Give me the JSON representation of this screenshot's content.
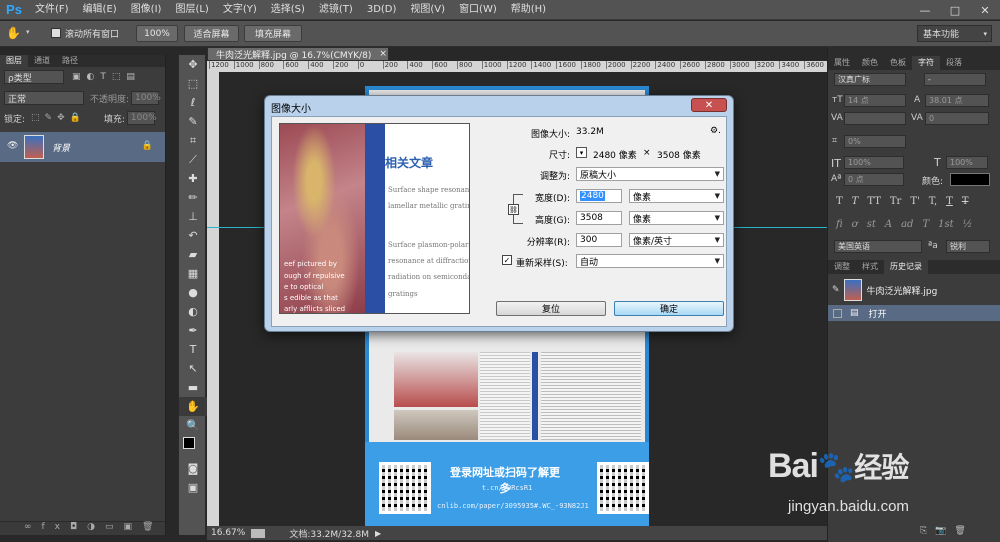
{
  "menubar": {
    "logo": "Ps",
    "items": [
      "文件(F)",
      "编辑(E)",
      "图像(I)",
      "图层(L)",
      "文字(Y)",
      "选择(S)",
      "滤镜(T)",
      "3D(D)",
      "视图(V)",
      "窗口(W)",
      "帮助(H)"
    ],
    "controls": [
      "—",
      "□",
      "✕"
    ]
  },
  "options": {
    "scroll_all_windows": "滚动所有窗口",
    "zoom_100": "100%",
    "fit_screen": "适合屏幕",
    "fill_screen": "填充屏幕",
    "workspace": "基本功能"
  },
  "layers_panel": {
    "tabs": [
      "图层",
      "通道",
      "路径"
    ],
    "kind_label": "ρ类型",
    "blend_mode": "正常",
    "opacity_label": "不透明度:",
    "opacity_value": "100%",
    "lock_label": "锁定:",
    "fill_label": "填充:",
    "fill_value": "100%",
    "layer_name": "背景"
  },
  "document": {
    "tab_title": "牛肉泛光解释.jpg @ 16.7%(CMYK/8)",
    "close": "×",
    "ruler_ticks": [
      "1200",
      "1000",
      "800",
      "600",
      "400",
      "200",
      "0",
      "200",
      "400",
      "600",
      "800",
      "1000",
      "1200",
      "1400",
      "1600",
      "1800",
      "2000",
      "2200",
      "2400",
      "2600",
      "2800",
      "3000",
      "3200",
      "3400",
      "3600"
    ],
    "zoom": "16.67%",
    "doc_info": "文档:33.2M/32.8M",
    "poster_cta": "登录网址或扫码了解更多",
    "poster_link1": "t.cn/z0RcsR1",
    "poster_link2": "cnlib.com/paper/3095935#.WC_-93N82J1"
  },
  "dialog": {
    "title": "图像大小",
    "close": "✕",
    "image_size_label": "图像大小:",
    "image_size_value": "33.2M",
    "gear": "⚙.",
    "dimensions_label": "尺寸:",
    "dimensions_width": "2480 像素",
    "dimensions_x": "×",
    "dimensions_height": "3508 像素",
    "fit_to_label": "调整为:",
    "fit_to_value": "原稿大小",
    "width_label": "宽度(D):",
    "width_value": "2480",
    "width_unit": "像素",
    "height_label": "高度(G):",
    "height_value": "3508",
    "height_unit": "像素",
    "resolution_label": "分辨率(R):",
    "resolution_value": "300",
    "resolution_unit": "像素/英寸",
    "resample_label": "重新采样(S):",
    "resample_value": "自动",
    "reset_button": "复位",
    "ok_button": "确定",
    "preview": {
      "heading": "相关文章",
      "lines": [
        "Surface shape resonance",
        "lamellar metallic grating",
        "Surface plasmon-polari",
        "resonance at diffraction",
        "radiation on semiconda",
        "gratings"
      ],
      "left_lines": [
        "eef pictured by",
        "ough of repulsive",
        "e to optical",
        "s edible as that",
        "arly afflicts sliced"
      ]
    }
  },
  "right_panel": {
    "tabs_top": [
      "属性",
      "颜色",
      "色板",
      "字符",
      "段落"
    ],
    "font_family": "汉真广标",
    "font_style": "-",
    "font_size": "14 点",
    "leading": "38.01 点",
    "kerning": "0",
    "tracking_scale": "0%",
    "vscale": "100%",
    "hscale": "100%",
    "baseline": "0 点",
    "color_label": "颜色:",
    "style_row1": [
      "T",
      "T",
      "TT",
      "Tr",
      "T'",
      "T,",
      "T",
      "T"
    ],
    "style_row2": [
      "fi",
      "ơ",
      "st",
      "A",
      "ad",
      "T",
      "1st",
      "½"
    ],
    "language": "美国英语",
    "aa_icon": "a",
    "aa_mode": "锐利",
    "tabs_bottom": [
      "调整",
      "样式",
      "历史记录"
    ],
    "history_image": "牛肉泛光解释.jpg",
    "history_open": "打开"
  },
  "watermark": {
    "logo": "Bai",
    "logo_paw": "du",
    "logo_cn": "经验",
    "url": "jingyan.baidu.com"
  }
}
